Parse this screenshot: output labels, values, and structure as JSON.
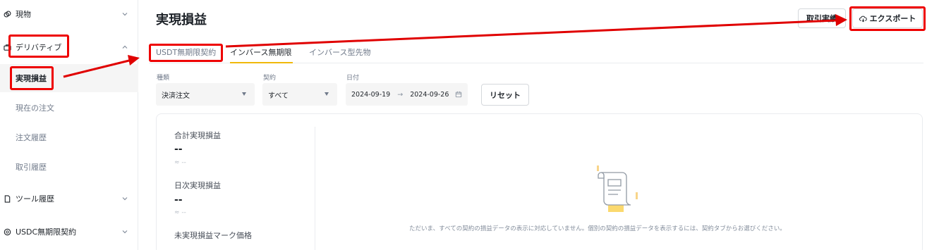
{
  "sidebar": {
    "items": [
      {
        "label": "現物",
        "icon": "spot-icon"
      },
      {
        "label": "デリバティブ",
        "icon": "derivatives-icon"
      },
      {
        "label": "ツール履歴",
        "icon": "tool-history-icon"
      },
      {
        "label": "USDⒸ無期限契約",
        "icon": "usdc-icon"
      }
    ],
    "subitems": [
      "実現損益",
      "現在の注文",
      "注文履歴",
      "取引履歴"
    ],
    "usdc_label": "USDC無期限契約"
  },
  "header": {
    "title": "実現損益",
    "trade_history_label": "取引実績",
    "export_label": "エクスポート"
  },
  "tabs": [
    "USDT無期限契約",
    "インバース無期限",
    "インバース型先物"
  ],
  "filters": {
    "type_label": "種類",
    "type_value": "決済注文",
    "contract_label": "契約",
    "contract_value": "すべて",
    "date_label": "日付",
    "date_start": "2024-09-19",
    "date_sep": "→",
    "date_end": "2024-09-26",
    "reset_label": "リセット"
  },
  "stats": {
    "total_label": "合計実現損益",
    "total_value": "--",
    "total_approx": "≈ --",
    "daily_label": "日次実現損益",
    "daily_value": "--",
    "daily_approx": "≈ --",
    "unrealized_label": "未実現損益マーク価格"
  },
  "empty_message": "ただいま、すべての契約の損益データの表示に対応していません。個別の契約の損益データを表示するには、契約タブからお選びください。",
  "colors": {
    "accent": "#f0b90b",
    "annotation": "#e00000"
  }
}
